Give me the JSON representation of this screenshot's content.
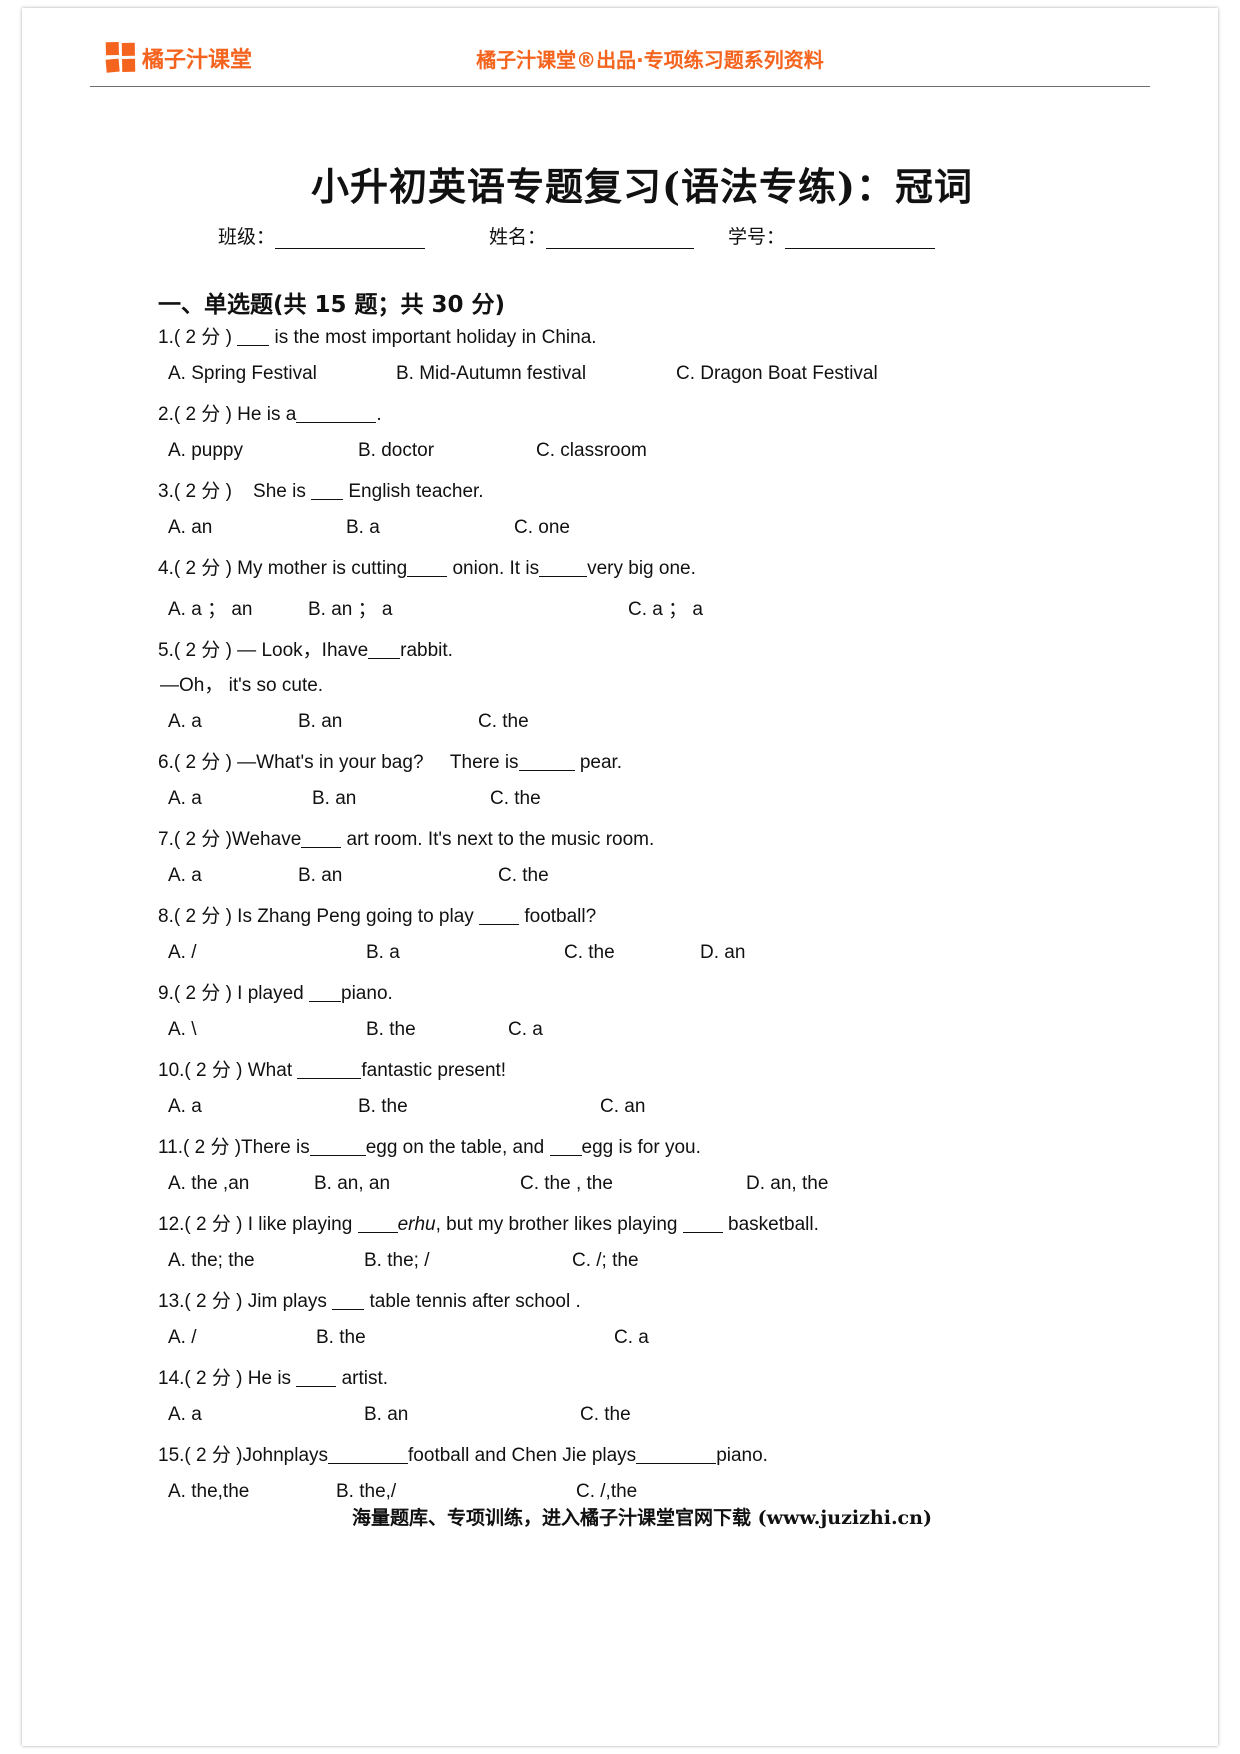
{
  "header": {
    "brand_name": "橘子汁课堂",
    "tagline": "橘子汁课堂®出品·专项练习题系列资料",
    "brand_color": "#f4641e"
  },
  "title": "小升初英语专题复习(语法专练)：冠词",
  "meta": {
    "class_label": "班级：",
    "name_label": "姓名：",
    "id_label": "学号："
  },
  "section": {
    "heading": "一、单选题(共 15 题；共 30 分)"
  },
  "questions": [
    {
      "num": "1.",
      "points": "( 2 分 )",
      "stem_parts": [
        "",
        "BLANK:48",
        " is the most important holiday in China."
      ],
      "stem": "1.( 2 分 ) ____ is the most important holiday in China.",
      "options": [
        "A. Spring Festival",
        "B. Mid-Autumn festival",
        "C. Dragon Boat Festival"
      ],
      "opt_widths": [
        228,
        280,
        0
      ]
    },
    {
      "num": "2.",
      "points": "( 2 分 )",
      "stem": "2.( 2 分 ) He is a__________.",
      "options": [
        "A. puppy",
        "B. doctor",
        "C. classroom"
      ],
      "opt_widths": [
        190,
        178,
        0
      ]
    },
    {
      "num": "3.",
      "points": "( 2 分 )",
      "stem": "3.( 2 分 )    She is ____ English teacher.",
      "options": [
        "A. an",
        "B. a",
        "C. one"
      ],
      "opt_widths": [
        178,
        168,
        0
      ]
    },
    {
      "num": "4.",
      "points": "( 2 分 )",
      "stem": "4.( 2 分 ) My mother is cutting_____ onion. It is______very big one.",
      "options": [
        "A. a ； an",
        "B. an ； a",
        "C. a ； a"
      ],
      "opt_widths": [
        140,
        320,
        0
      ]
    },
    {
      "num": "5.",
      "points": "( 2 分 )",
      "stem": "5.( 2 分 ) — Look，Ihave____rabbit.",
      "cont": "—Oh， it's so cute.",
      "options": [
        "A. a",
        "B. an",
        "C. the"
      ],
      "opt_widths": [
        130,
        180,
        0
      ]
    },
    {
      "num": "6.",
      "points": "( 2 分 )",
      "stem": "6.( 2 分 ) —What's in your bag?     There is_______ pear.",
      "options": [
        "A. a",
        "B. an",
        "C. the"
      ],
      "opt_widths": [
        144,
        178,
        0
      ]
    },
    {
      "num": "7.",
      "points": "( 2 分 )",
      "stem": "7.( 2 分 )Wehave_____ art room. It's next to the music room.",
      "options": [
        "A. a",
        "B. an",
        "C. the"
      ],
      "opt_widths": [
        130,
        200,
        0
      ]
    },
    {
      "num": "8.",
      "points": "( 2 分 )",
      "stem": "8.( 2 分 ) Is Zhang Peng going to play _____ football?",
      "options": [
        "A. /",
        "B. a",
        "C. the",
        "D. an"
      ],
      "opt_widths": [
        198,
        198,
        136
      ]
    },
    {
      "num": "9.",
      "points": "( 2 分 )",
      "stem": "9.( 2 分 ) I played ____piano.",
      "options": [
        "A. \\",
        "B. the",
        "C. a"
      ],
      "opt_widths": [
        198,
        142,
        0
      ]
    },
    {
      "num": "10.",
      "points": "( 2 分 )",
      "stem": "10.( 2 分 ) What ________fantastic present!",
      "options": [
        "A. a",
        "B. the",
        "C. an"
      ],
      "opt_widths": [
        190,
        242,
        0
      ]
    },
    {
      "num": "11.",
      "points": "( 2 分 )",
      "stem": "11.( 2 分 )There is_______egg on the table, and ____egg is for you.",
      "options": [
        "A. the ,an",
        "B. an, an",
        "C. the , the",
        "D. an, the"
      ],
      "opt_widths": [
        146,
        206,
        226
      ]
    },
    {
      "num": "12.",
      "points": "( 2 分 )",
      "stem": "12.( 2 分 ) I like playing _____erhu, but my brother likes playing _____ basketball.",
      "options": [
        "A. the; the",
        "B. the; /",
        "C. /; the"
      ],
      "opt_widths": [
        196,
        208,
        0
      ]
    },
    {
      "num": "13.",
      "points": "( 2 分 )",
      "stem": "13.( 2 分 ) Jim plays ____ table tennis after school .",
      "options": [
        "A. /",
        "B. the",
        "C. a"
      ],
      "opt_widths": [
        148,
        298,
        0
      ]
    },
    {
      "num": "14.",
      "points": "( 2 分 )",
      "stem": "14.( 2 分 ) He is _____ artist.",
      "options": [
        "A. a",
        "B. an",
        "C. the"
      ],
      "opt_widths": [
        196,
        216,
        0
      ]
    },
    {
      "num": "15.",
      "points": "( 2 分 )",
      "stem": "15.( 2 分 )Johnplays__________football and Chen Jie plays__________piano.",
      "options": [
        "A. the,the",
        "B. the,/",
        "C. /,the"
      ],
      "opt_widths": [
        168,
        240,
        0
      ]
    }
  ],
  "footer": "海量题库、专项训练，进入橘子汁课堂官网下载 (www.juzizhi.cn)"
}
